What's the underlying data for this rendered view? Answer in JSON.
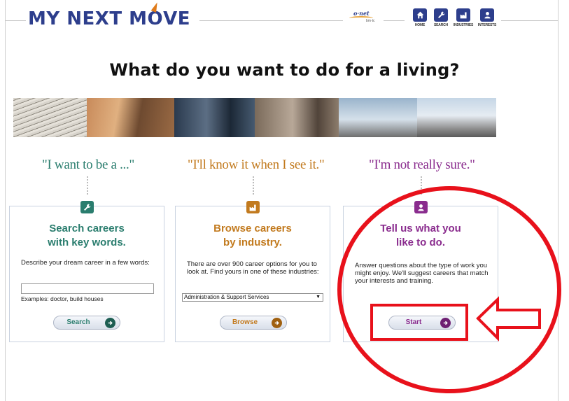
{
  "header": {
    "logo": "MY NEXT MOVE",
    "logo_parts": [
      "MY NEXT M",
      "O",
      "VE"
    ],
    "onet": "o·net",
    "onet_sub": "bm·tc",
    "nav": [
      {
        "label": "HOME",
        "icon": "home-icon"
      },
      {
        "label": "SEARCH",
        "icon": "wrench-icon"
      },
      {
        "label": "INDUSTRIES",
        "icon": "industry-icon"
      },
      {
        "label": "INTERESTS",
        "icon": "person-icon"
      }
    ]
  },
  "title": "What do you want to do for a living?",
  "columns": [
    {
      "tagline": "\"I want to be a ...\"",
      "heading_1": "Search careers",
      "heading_2": "with key words.",
      "description": "Describe your dream career in a few words:",
      "input_value": "",
      "examples": "Examples: doctor, build houses",
      "button": "Search",
      "color": "#2a7d6e"
    },
    {
      "tagline": "\"I'll know it when I see it.\"",
      "heading_1": "Browse careers",
      "heading_2": "by industry.",
      "description": "There are over 900 career options for you to look at. Find yours in one of these industries:",
      "select_value": "Administration & Support Services",
      "button": "Browse",
      "color": "#c27a1e"
    },
    {
      "tagline": "\"I'm not really sure.\"",
      "heading_1": "Tell us what you",
      "heading_2": "like to do.",
      "description": "Answer questions about the type of work you might enjoy. We'll suggest careers that match your interests and training.",
      "button": "Start",
      "color": "#8a2c8e"
    }
  ],
  "colors": {
    "brand": "#2d3e8c",
    "annotation": "#e8111b"
  }
}
